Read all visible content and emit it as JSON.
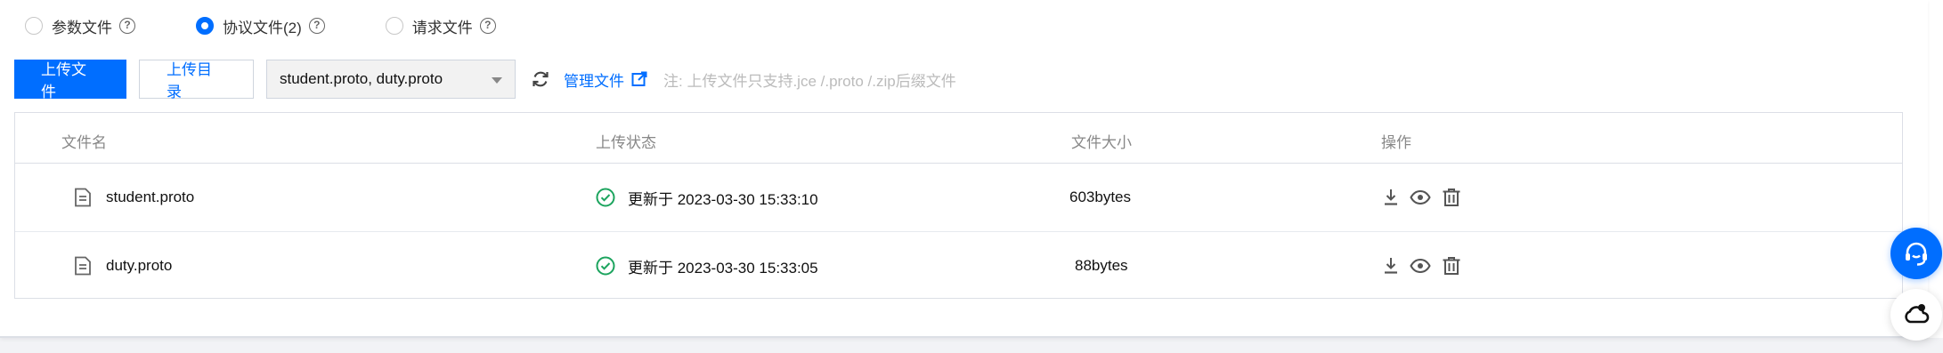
{
  "radios": [
    {
      "label": "参数文件",
      "checked": false
    },
    {
      "label": "协议文件(2)",
      "checked": true
    },
    {
      "label": "请求文件",
      "checked": false
    }
  ],
  "toolbar": {
    "upload_file": "上传文件",
    "upload_dir": "上传目录",
    "select_value": "student.proto, duty.proto",
    "manage": "管理文件",
    "note": "注: 上传文件只支持.jce /.proto /.zip后缀文件"
  },
  "table": {
    "headers": {
      "name": "文件名",
      "status": "上传状态",
      "size": "文件大小",
      "ops": "操作"
    },
    "rows": [
      {
        "name": "student.proto",
        "status": "更新于 2023-03-30 15:33:10",
        "size": "603bytes"
      },
      {
        "name": "duty.proto",
        "status": "更新于 2023-03-30 15:33:05",
        "size": "88bytes"
      }
    ]
  },
  "colors": {
    "accent": "#006eff",
    "success": "#1ca45e"
  }
}
